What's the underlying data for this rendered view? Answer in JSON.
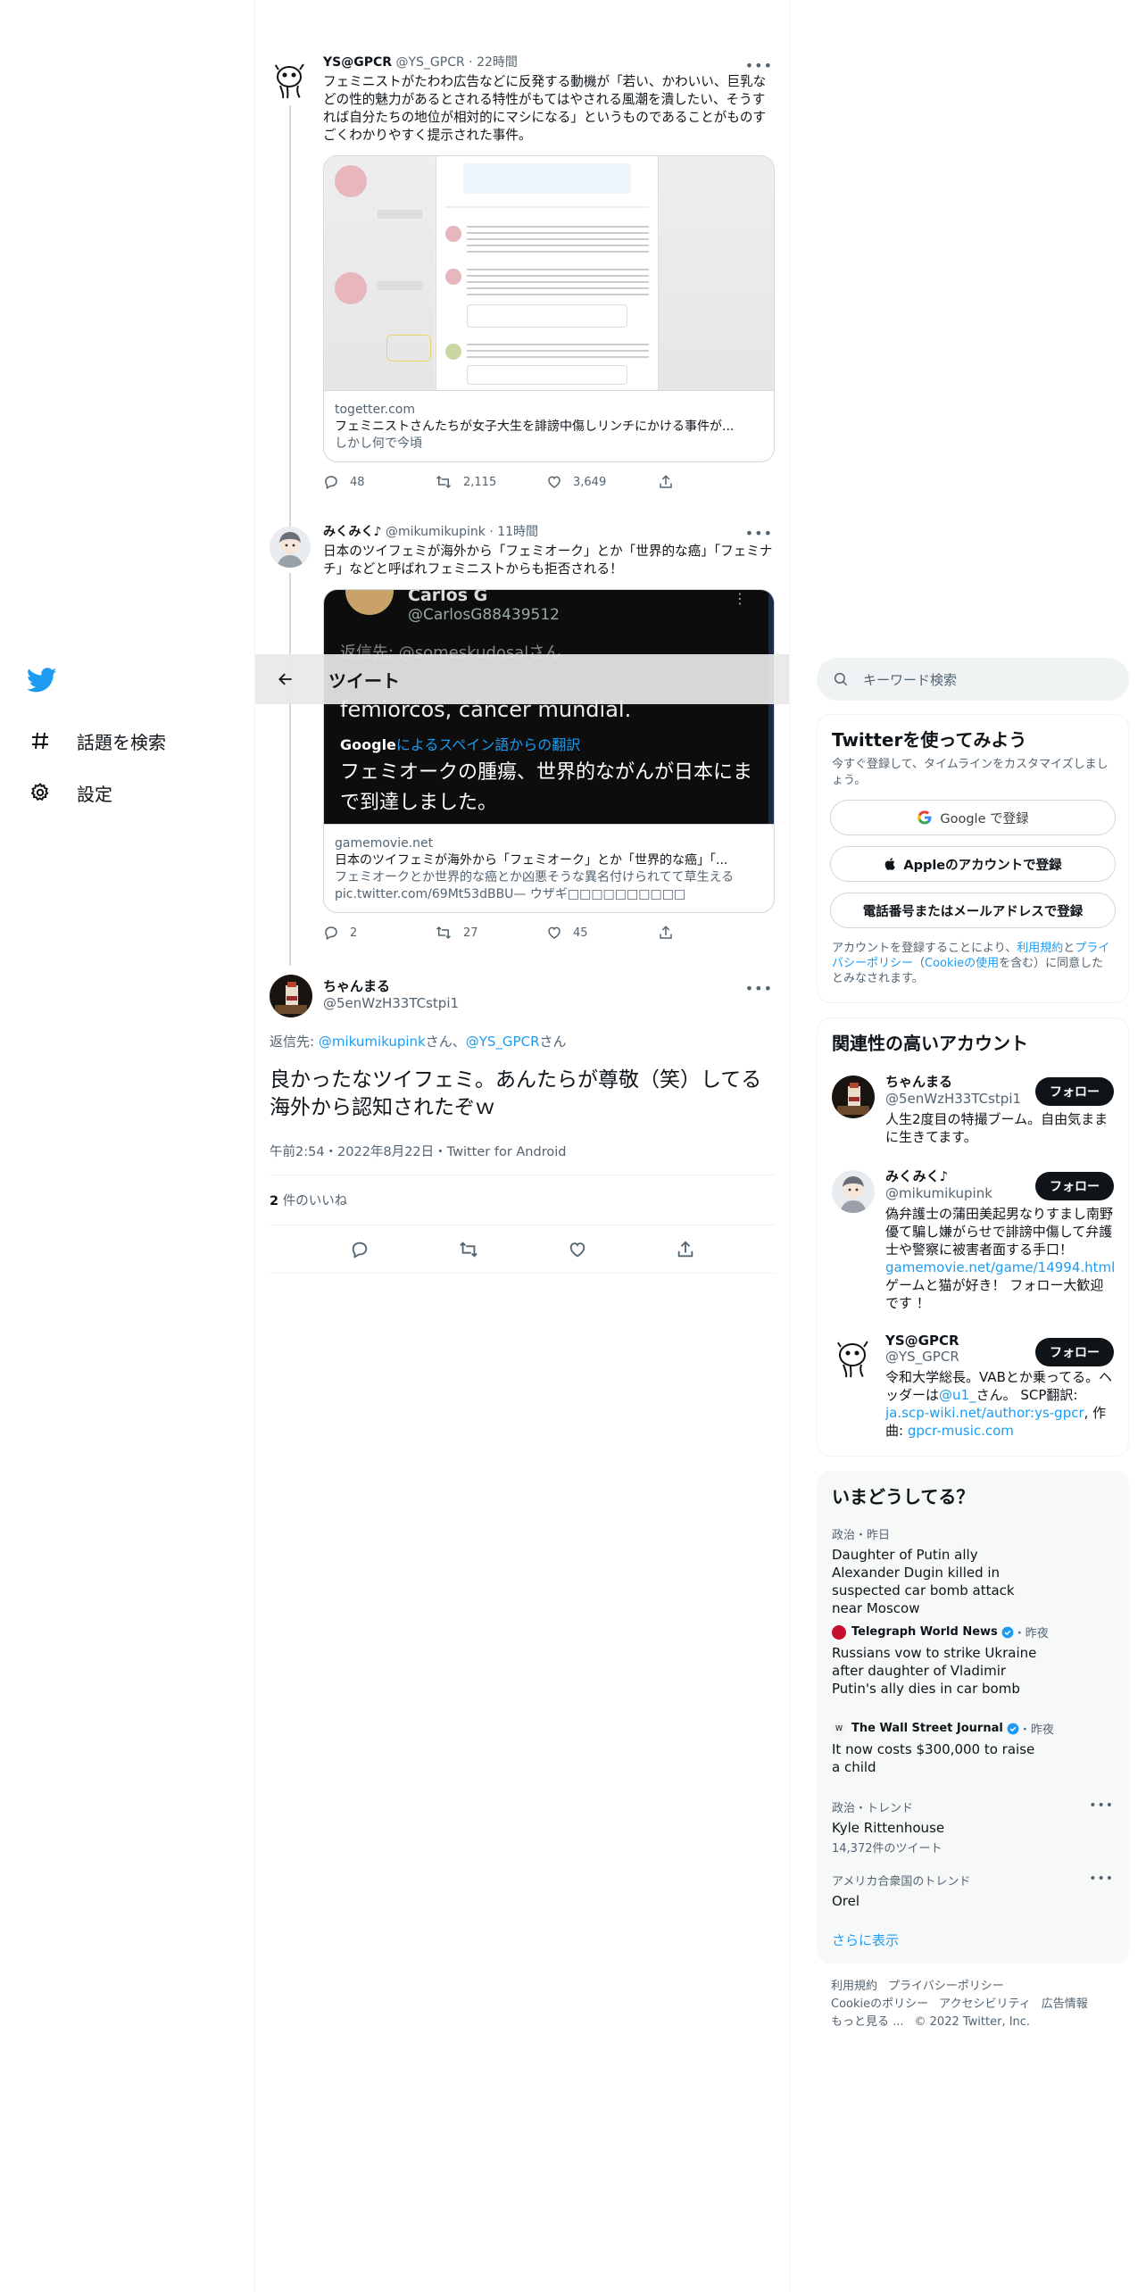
{
  "nav": {
    "explore_label": "話題を検索",
    "settings_label": "設定"
  },
  "header": {
    "title": "ツイート"
  },
  "tweets": [
    {
      "name": "YS@GPCR",
      "handle": "@YS_GPCR",
      "time": "22時間",
      "text": "フェミニストがたわわ広告などに反発する動機が「若い、かわいい、巨乳などの性的魅力があるとされる特性がもてはやされる風潮を潰したい、そうすれば自分たちの地位が相対的にマシになる」というものであることがものすごくわかりやすく提示された事件。",
      "card": {
        "domain": "togetter.com",
        "title": "フェミニストさんたちが女子大生を誹謗中傷しリンチにかける事件が...",
        "description": "しかし何で今頃"
      },
      "replies": "48",
      "retweets": "2,115",
      "likes": "3,649"
    },
    {
      "name": "みくみく♪",
      "handle": "@mikumikupink",
      "time": "11時間",
      "text": "日本のツイフェミが海外から「フェミオーク」とか「世界的な癌」「フェミナチ」などと呼ばれフェミニストからも拒否される！",
      "card": {
        "image_line1": "Carlos G",
        "image_line2": "@CarlosG88439512",
        "image_line3": "返信先: @someskudosalさん",
        "image_line4": "femiorcos, cáncer mundial.",
        "image_translate": "によるスペイン語からの翻訳",
        "image_google": "Google",
        "image_line5": "フェミオークの腫瘍、世界的ながんが日本にまで到達しました。",
        "domain": "gamemovie.net",
        "title": "日本のツイフェミが海外から「フェミオーク」とか「世界的な癌」「...",
        "description": "フェミオークとか世界的な癌とか凶悪そうな異名付けられてて草生える pic.twitter.com/69Mt53dBBU— ウザギ□□□□□□□□□□ □□□□□□□□□□"
      },
      "replies": "2",
      "retweets": "27",
      "likes": "45"
    }
  ],
  "main_tweet": {
    "name": "ちゃんまる",
    "handle": "@5enWzH33TCstpi1",
    "reply_prefix": "返信先: ",
    "reply_to_1": "@mikumikupink",
    "reply_mid": "さん、",
    "reply_to_2": "@YS_GPCR",
    "reply_suffix": "さん",
    "text": "良かったなツイフェミ。あんたらが尊敬（笑）してる海外から認知されたぞｗ",
    "timestamp": "午前2:54・2022年8月22日・Twitter for Android",
    "likes_count": "2",
    "likes_label": " 件のいいね"
  },
  "search": {
    "placeholder": "キーワード検索"
  },
  "signup": {
    "title": "Twitterを使ってみよう",
    "desc": "今すぐ登録して、タイムラインをカスタマイズしましょう。",
    "google_btn": "Google で登録",
    "apple_btn": "Appleのアカウントで登録",
    "phone_btn": "電話番号またはメールアドレスで登録",
    "legal_1": "アカウントを登録することにより、",
    "legal_terms": "利用規約",
    "legal_2": "と",
    "legal_privacy": "プライバシーポリシー",
    "legal_3": "（",
    "legal_cookie": "Cookieの使用",
    "legal_4": "を含む）に同意したとみなされます。"
  },
  "related": {
    "title": "関連性の高いアカウント",
    "follow_label": "フォロー",
    "accounts": [
      {
        "name": "ちゃんまる",
        "handle": "@5enWzH33TCstpi1",
        "bio": "人生2度目の特撮ブーム。自由気ままに生きてます。"
      },
      {
        "name": "みくみく♪",
        "handle": "@mikumikupink",
        "bio": "偽弁護士の蒲田美起男なりすまし南野優て騙し嫌がらせで誹謗中傷して弁護士や警察に被害者面する手口！",
        "link": "gamemovie.net/game/14994.html",
        "bio2": "ゲームと猫が好き！ フォロー大歓迎です ！"
      },
      {
        "name": "YS@GPCR",
        "handle": "@YS_GPCR",
        "bio": "令和大学総長。VABとか乗ってる。ヘッダーは",
        "bio_link1": "@u1_",
        "bio_mid": "さん。 SCP翻訳:",
        "bio_link2": "ja.scp-wiki.net/author:ys-gpcr",
        "bio_end": ", 作曲:",
        "bio_link3": "gpcr-music.com"
      }
    ]
  },
  "trends": {
    "title": "いまどうしてる？",
    "items": [
      {
        "context": "政治・昨日",
        "text": "Daughter of Putin ally Alexander Dugin killed in suspected car bomb attack near Moscow"
      },
      {
        "source": "Telegraph World News",
        "context": "・昨夜",
        "text": "Russians vow to strike Ukraine after daughter of Vladimir Putin's ally dies in car bomb"
      },
      {
        "source": "The Wall Street Journal",
        "context": "・昨夜",
        "text": "It now costs $300,000 to raise a child"
      },
      {
        "context": "政治・トレンド",
        "text": "Kyle Rittenhouse",
        "count": "14,372件のツイート"
      },
      {
        "context": "アメリカ合衆国のトレンド",
        "text": "Orel"
      }
    ],
    "show_more": "さらに表示"
  },
  "footer": {
    "terms": "利用規約",
    "privacy": "プライバシーポリシー",
    "cookie": "Cookieのポリシー",
    "accessibility": "アクセシビリティ",
    "ads": "広告情報",
    "more": "もっと見る ...",
    "copyright": "© 2022 Twitter, Inc."
  },
  "colors": {
    "accent": "#1d9bf0",
    "text": "#0f1419",
    "muted": "#536471"
  }
}
